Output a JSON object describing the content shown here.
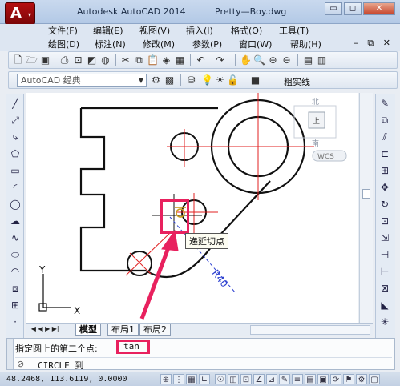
{
  "window": {
    "app_title": "Autodesk AutoCAD 2014",
    "file_name": "Pretty—Boy.dwg",
    "min_glyph": "▭",
    "restore_glyph": "◻",
    "close_glyph": "✕"
  },
  "app_button": {
    "glyph": "A",
    "dropdown_glyph": "▾"
  },
  "menu": {
    "row1": [
      "文件(F)",
      "编辑(E)",
      "视图(V)",
      "插入(I)",
      "格式(O)",
      "工具(T)"
    ],
    "row2": [
      "绘图(D)",
      "标注(N)",
      "修改(M)",
      "参数(P)",
      "窗口(W)",
      "帮助(H)"
    ],
    "mdi_controls": "–  ⧉  ✕"
  },
  "toolbar": {
    "workspace": "AutoCAD 经典",
    "layer_label": "粗实线"
  },
  "viewcube": {
    "north": "北",
    "top": "上",
    "south": "南",
    "wcs": "WCS"
  },
  "drawing": {
    "tooltip": "递延切点",
    "dimension": "R40",
    "ucs_y": "Y",
    "ucs_x": "X"
  },
  "tabs": {
    "nav": "|◀ ◀ ▶ ▶|",
    "items": [
      "模型",
      "布局1",
      "布局2"
    ],
    "active": "模型"
  },
  "command": {
    "prompt": "指定圆上的第二个点:",
    "typed": "tan",
    "history_text": "CIRCLE 到",
    "history_icon": "⊘"
  },
  "status": {
    "coordinates": "48.2468,  113.6119, 0.0000"
  },
  "colors": {
    "highlight": "#e8215e",
    "crosshair": "#e02020",
    "dimension": "#2b3fd0",
    "geometry": "#111111"
  }
}
